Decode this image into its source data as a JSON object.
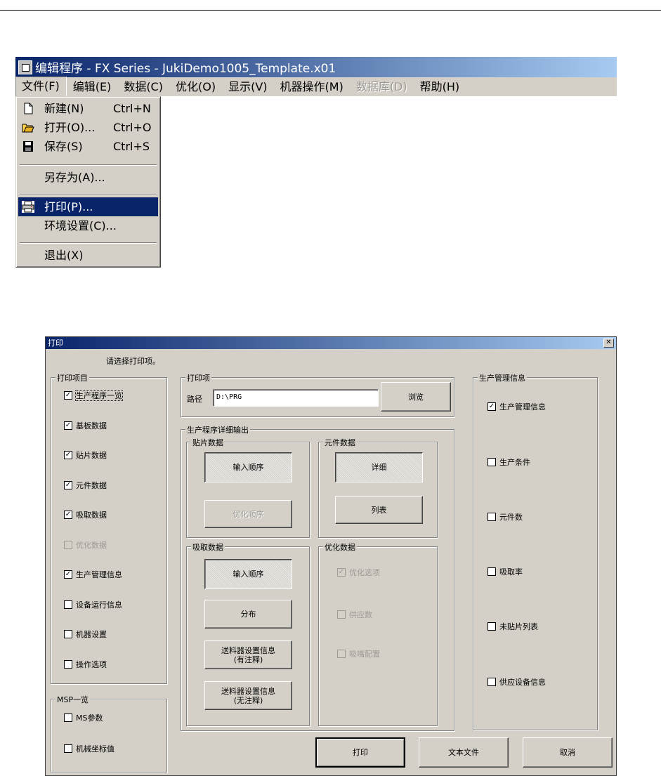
{
  "app": {
    "title": "编辑程序 - FX Series - JukiDemo1005_Template.x01",
    "menu": [
      "文件(F)",
      "编辑(E)",
      "数据(C)",
      "优化(O)",
      "显示(V)",
      "机器操作(M)",
      "数据库(D)",
      "帮助(H)"
    ],
    "menu_disabled_index": 6
  },
  "file_menu": {
    "new": {
      "label": "新建(N)",
      "shortcut": "Ctrl+N"
    },
    "open": {
      "label": "打开(O)...",
      "shortcut": "Ctrl+O"
    },
    "save": {
      "label": "保存(S)",
      "shortcut": "Ctrl+S"
    },
    "save_as": {
      "label": "另存为(A)..."
    },
    "print": {
      "label": "打印(P)..."
    },
    "env": {
      "label": "环境设置(C)..."
    },
    "exit": {
      "label": "退出(X)"
    }
  },
  "dialog": {
    "title": "打印",
    "instruction": "请选择打印项。",
    "print_items": {
      "label": "打印项目",
      "items": [
        {
          "label": "生产程序一览",
          "checked": true
        },
        {
          "label": "基板数据",
          "checked": true
        },
        {
          "label": "贴片数据",
          "checked": true
        },
        {
          "label": "元件数据",
          "checked": true
        },
        {
          "label": "吸取数据",
          "checked": true
        },
        {
          "label": "优化数据",
          "checked": false,
          "disabled": true
        },
        {
          "label": "生产管理信息",
          "checked": true
        },
        {
          "label": "设备运行信息",
          "checked": false
        },
        {
          "label": "机器设置",
          "checked": false
        },
        {
          "label": "操作选项",
          "checked": false
        }
      ]
    },
    "msp": {
      "label": "MSP一览",
      "items": [
        {
          "label": "MS参数",
          "checked": false
        },
        {
          "label": "机械坐标值",
          "checked": false
        }
      ]
    },
    "print_section": {
      "label": "打印项",
      "path_label": "路径",
      "path_value": "D:\\PRG",
      "browse": "浏览"
    },
    "detail": {
      "label": "生产程序详细输出",
      "placement": {
        "label": "贴片数据",
        "input_order": "输入顺序",
        "opt_order": "优化顺序"
      },
      "component": {
        "label": "元件数据",
        "detail": "详细",
        "list": "列表"
      },
      "pickup": {
        "label": "吸取数据",
        "input_order": "输入顺序",
        "distribution": "分布",
        "feeder_note": "送料器设置信息\n(有注释)",
        "feeder_no_note": "送料器设置信息\n(无注释)"
      },
      "optimize": {
        "label": "优化数据",
        "items": [
          {
            "label": "优化选项",
            "checked": true
          },
          {
            "label": "供应数",
            "checked": false
          },
          {
            "label": "吸嘴配置",
            "checked": false
          }
        ]
      }
    },
    "prod_mgmt": {
      "label": "生产管理信息",
      "items": [
        {
          "label": "生产管理信息",
          "checked": true
        },
        {
          "label": "生产条件",
          "checked": false
        },
        {
          "label": "元件数",
          "checked": false
        },
        {
          "label": "吸取率",
          "checked": false
        },
        {
          "label": "未贴片列表",
          "checked": false
        },
        {
          "label": "供应设备信息",
          "checked": false
        }
      ]
    },
    "buttons": {
      "print": "打印",
      "text_file": "文本文件",
      "cancel": "取消"
    }
  }
}
